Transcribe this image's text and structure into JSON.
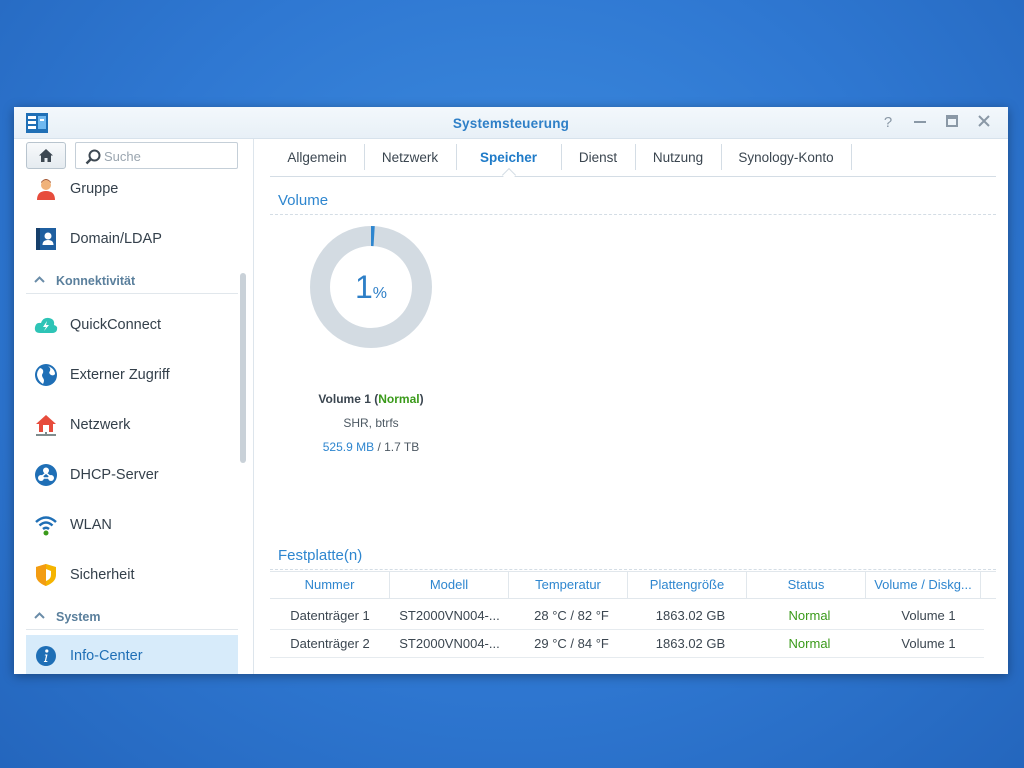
{
  "window": {
    "title": "Systemsteuerung"
  },
  "search": {
    "placeholder": "Suche"
  },
  "sidebar": {
    "items": [
      {
        "label": "Gruppe"
      },
      {
        "label": "Domain/LDAP"
      },
      {
        "label": "QuickConnect"
      },
      {
        "label": "Externer Zugriff"
      },
      {
        "label": "Netzwerk"
      },
      {
        "label": "DHCP-Server"
      },
      {
        "label": "WLAN"
      },
      {
        "label": "Sicherheit"
      },
      {
        "label": "Info-Center"
      }
    ],
    "sections": [
      {
        "label": "Konnektivität"
      },
      {
        "label": "System"
      }
    ]
  },
  "tabs": [
    {
      "label": "Allgemein"
    },
    {
      "label": "Netzwerk"
    },
    {
      "label": "Speicher"
    },
    {
      "label": "Dienst"
    },
    {
      "label": "Nutzung"
    },
    {
      "label": "Synology-Konto"
    }
  ],
  "active_tab": "Speicher",
  "volume": {
    "heading": "Volume",
    "percent": "1",
    "percent_sign": "%",
    "usage_fraction": 0.01,
    "name": "Volume 1",
    "status": "Normal",
    "type": "SHR, btrfs",
    "used": "525.9 MB",
    "total": "/ 1.7 TB"
  },
  "disks": {
    "heading": "Festplatte(n)",
    "columns": [
      "Nummer",
      "Modell",
      "Temperatur",
      "Plattengröße",
      "Status",
      "Volume / Diskg..."
    ],
    "rows": [
      [
        "Datenträger 1",
        "ST2000VN004-...",
        "28 °C / 82 °F",
        "1863.02 GB",
        "Normal",
        "Volume 1"
      ],
      [
        "Datenträger 2",
        "ST2000VN004-...",
        "29 °C / 84 °F",
        "1863.02 GB",
        "Normal",
        "Volume 1"
      ]
    ]
  },
  "colors": {
    "accent": "#2e7fc7",
    "ok": "#3a9a1a",
    "donut_track": "#d3dbe2"
  }
}
